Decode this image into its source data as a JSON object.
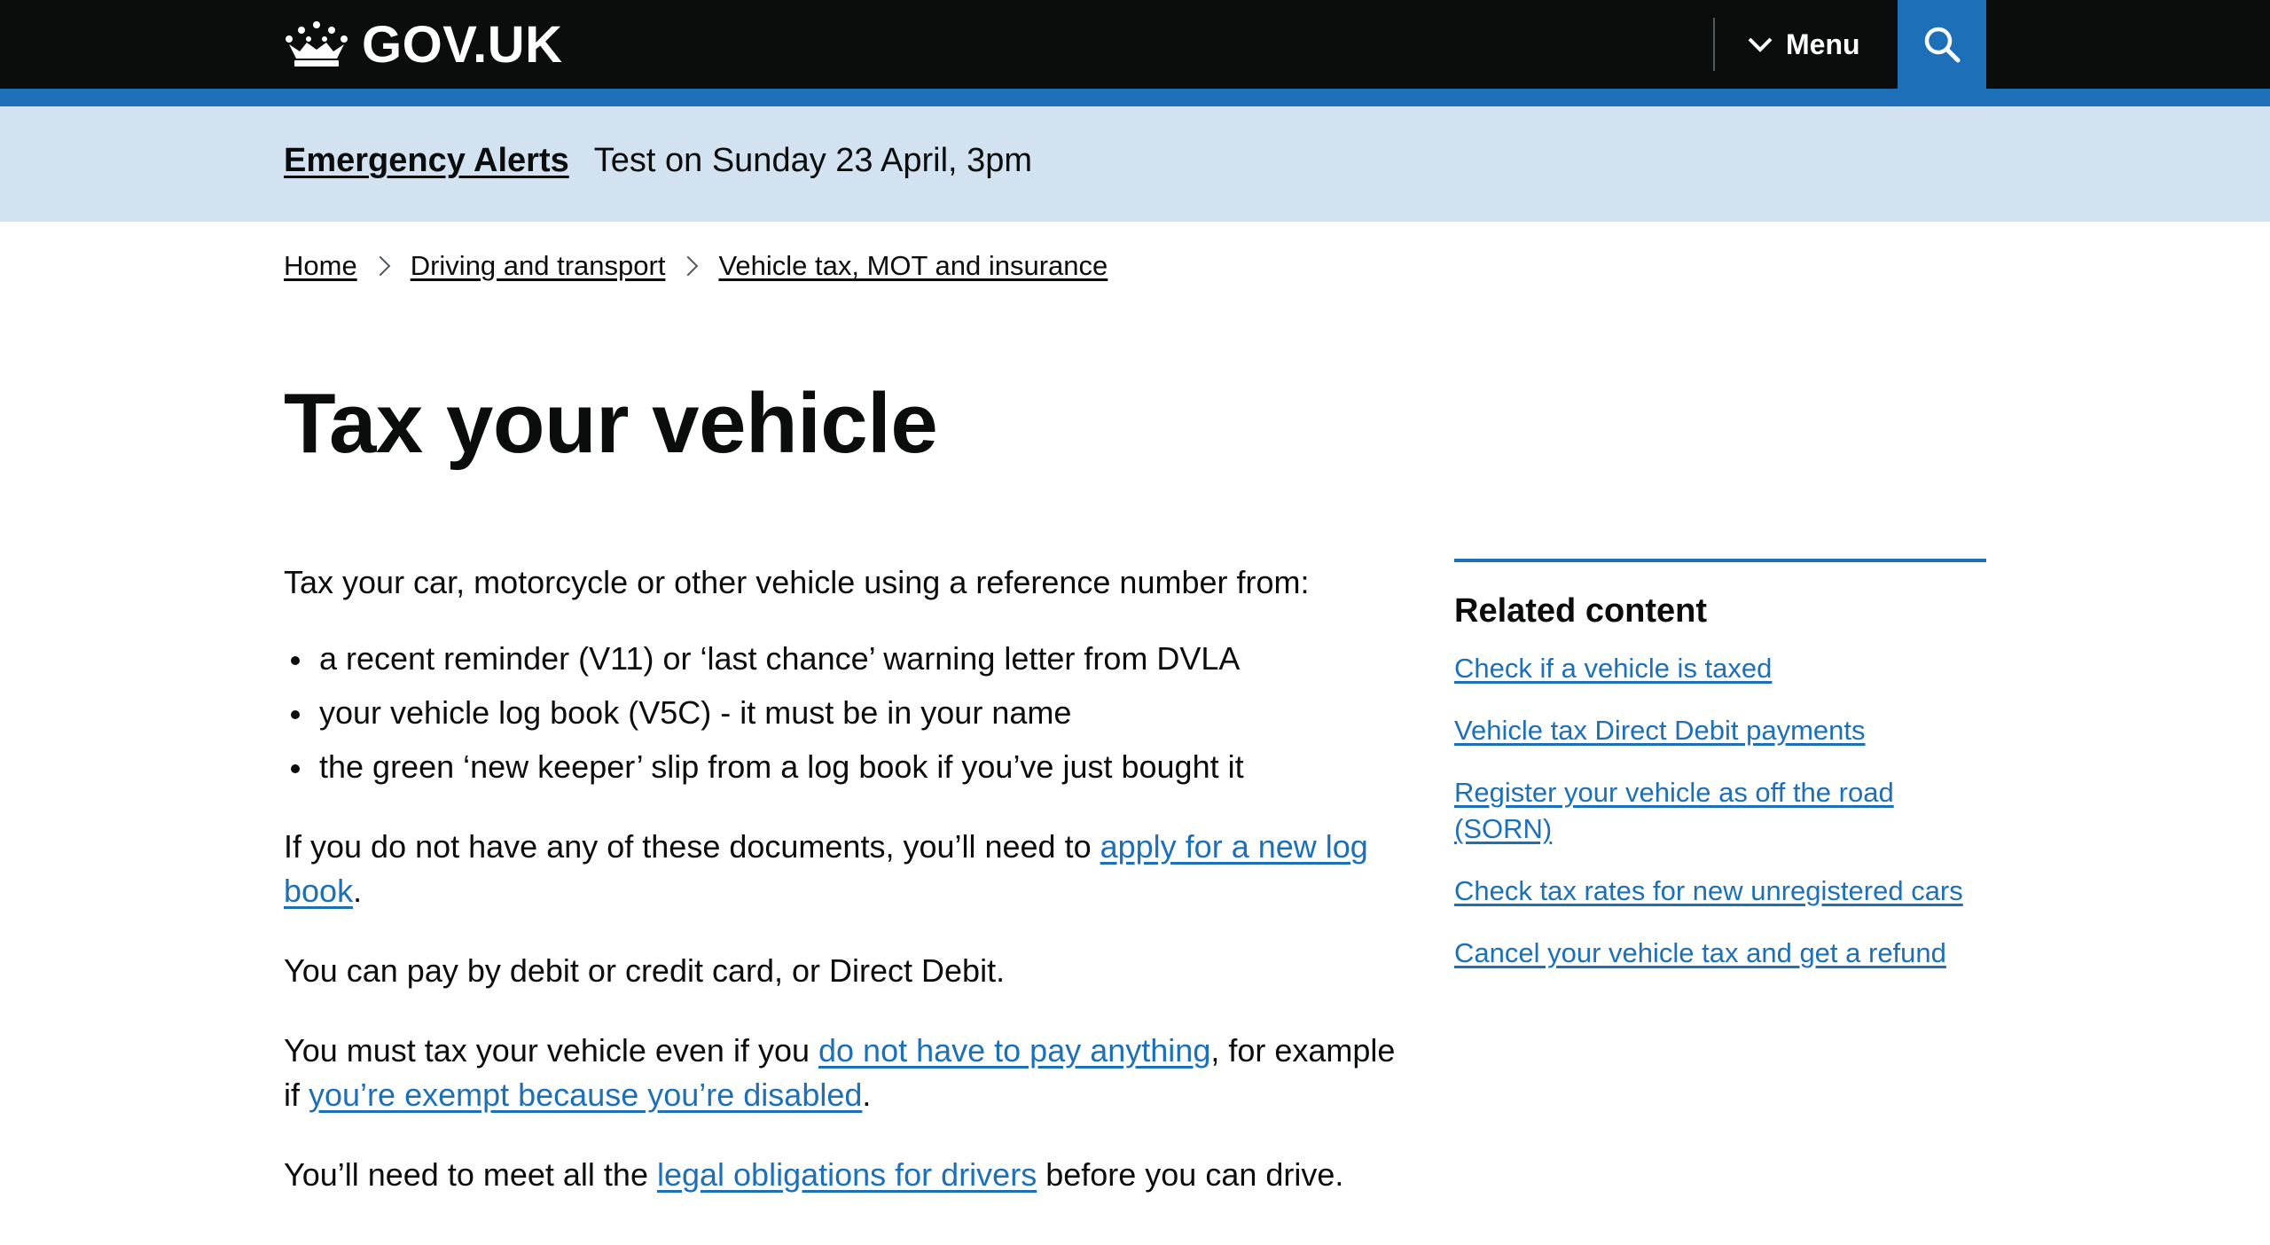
{
  "header": {
    "logo_text": "GOV.UK",
    "menu_label": "Menu",
    "colors": {
      "background": "#0b0c0c",
      "accent": "#1d70b8"
    }
  },
  "banner": {
    "link": "Emergency Alerts",
    "text": "Test on Sunday 23 April, 3pm"
  },
  "breadcrumb": {
    "items": [
      "Home",
      "Driving and transport",
      "Vehicle tax, MOT and insurance"
    ]
  },
  "page": {
    "title": "Tax your vehicle"
  },
  "content": {
    "intro": "Tax your car, motorcycle or other vehicle using a reference number from:",
    "bullets": [
      "a recent reminder (V11) or ‘last chance’ warning letter from DVLA",
      "your vehicle log book (V5C) - it must be in your name",
      "the green ‘new keeper’ slip from a log book if you’ve just bought it"
    ],
    "p2_before": "If you do not have any of these documents, you’ll need to ",
    "p2_link": "apply for a new log book",
    "p2_after": ".",
    "p3": "You can pay by debit or credit card, or Direct Debit.",
    "p4_before": "You must tax your vehicle even if you ",
    "p4_link1": "do not have to pay anything",
    "p4_mid": ", for example if ",
    "p4_link2": "you’re exempt because you’re disabled",
    "p4_after": ".",
    "p5_before": "You’ll need to meet all the ",
    "p5_link": "legal obligations for drivers",
    "p5_after": " before you can drive."
  },
  "related": {
    "title": "Related content",
    "links": [
      "Check if a vehicle is taxed",
      "Vehicle tax Direct Debit payments",
      "Register your vehicle as off the road (SORN)",
      "Check tax rates for new unregistered cars",
      "Cancel your vehicle tax and get a refund"
    ]
  }
}
